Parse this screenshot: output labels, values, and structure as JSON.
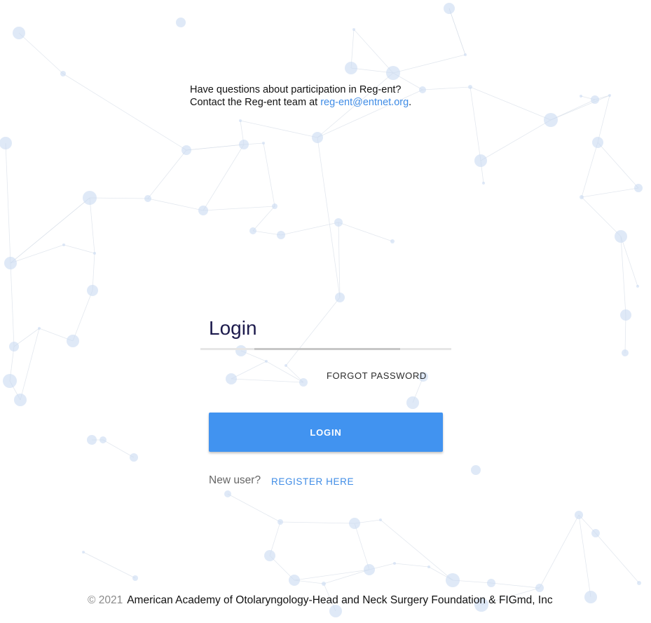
{
  "notice": {
    "line1": "Have questions about participation in Reg-ent?",
    "line2_prefix": "Contact the Reg-ent team at ",
    "email": "reg-ent@entnet.org",
    "line2_suffix": "."
  },
  "login": {
    "title": "Login",
    "forgot_label": "FORGOT PASSWORD",
    "button_label": "LOGIN",
    "new_user_text": "New user?",
    "register_label": "REGISTER HERE"
  },
  "footer": {
    "copyright": "© 2021",
    "organization": "American Academy of Otolaryngology-Head and Neck Surgery Foundation & FIGmd, Inc"
  },
  "colors": {
    "accent": "#4193f0",
    "link": "#3f8ce6",
    "title": "#1d1b4d",
    "network_node": "#c9dbf1",
    "network_line": "#d7dee8"
  }
}
